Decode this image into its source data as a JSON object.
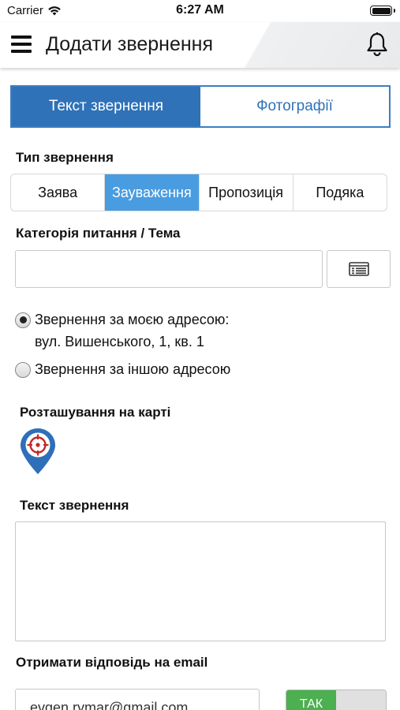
{
  "status_bar": {
    "carrier": "Carrier",
    "time": "6:27 AM"
  },
  "nav": {
    "title": "Додати звернення"
  },
  "tabs": [
    {
      "label": "Текст звернення",
      "active": true
    },
    {
      "label": "Фотографії",
      "active": false
    }
  ],
  "appeal_type": {
    "label": "Тип звернення",
    "options": [
      "Заява",
      "Зауваження",
      "Пропозиція",
      "Подяка"
    ],
    "selected": "Зауваження"
  },
  "category": {
    "label": "Категорія питання / Тема",
    "value": ""
  },
  "address": {
    "option_my": "Звернення за моєю адресою:",
    "my_address": "вул. Вишенського, 1, кв. 1",
    "option_other": "Звернення за іншою адресою",
    "selected": "my"
  },
  "map": {
    "label": "Розташування на карті"
  },
  "appeal_text": {
    "label": "Текст звернення",
    "value": ""
  },
  "email": {
    "label": "Отримати відповідь на email",
    "value": "evgen.rymar@gmail.com",
    "toggle_label": "ТАК"
  },
  "colors": {
    "tab_active": "#2f72b8",
    "segment_selected": "#4a9ce0",
    "pin_blue": "#2e6fb8",
    "pin_red": "#c62828",
    "toggle_on": "#4caf50"
  }
}
